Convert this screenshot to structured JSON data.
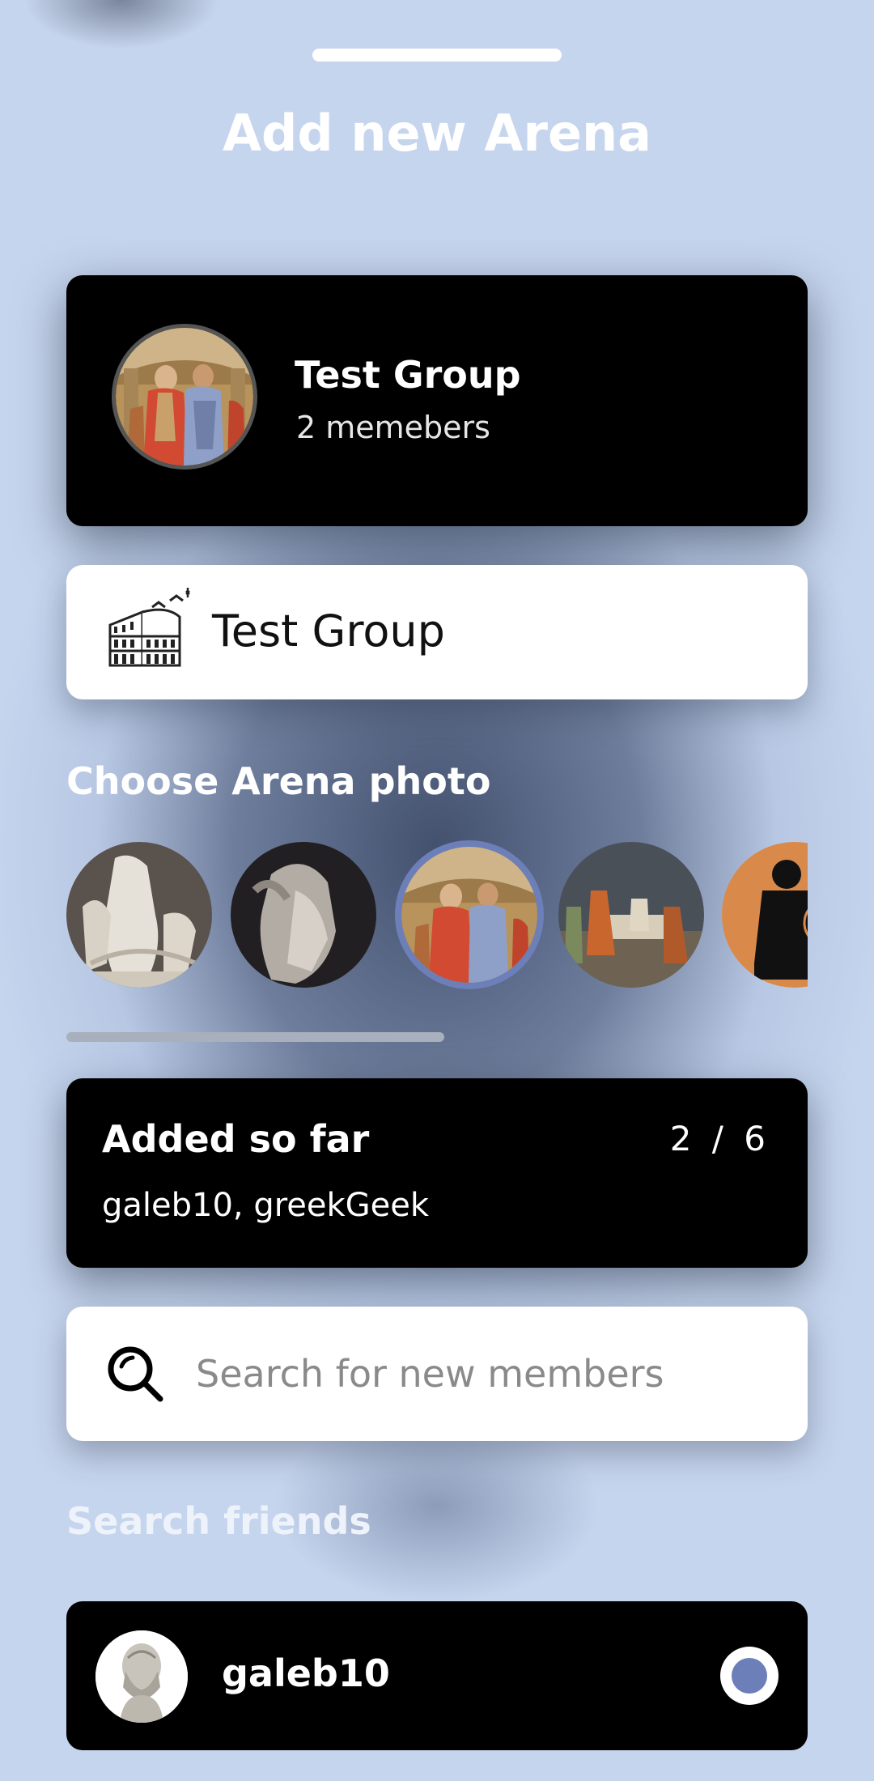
{
  "header": {
    "title": "Add new Arena"
  },
  "group_card": {
    "name": "Test Group",
    "members": "2 memebers",
    "avatar_icon": "school-of-athens-image"
  },
  "name_input": {
    "value": "Test Group",
    "icon": "colosseum-icon"
  },
  "photo_section": {
    "title": "Choose Arena photo",
    "photos": [
      {
        "name": "laocoon-statue-image",
        "selected": false
      },
      {
        "name": "rape-of-proserpina-statue-image",
        "selected": false
      },
      {
        "name": "school-of-athens-image",
        "selected": true
      },
      {
        "name": "death-of-socrates-image",
        "selected": false
      },
      {
        "name": "greek-pottery-warrior-image",
        "selected": false
      }
    ],
    "scroll_progress": 0.51,
    "accent_color": "#6c7fb8"
  },
  "added_card": {
    "title": "Added so far",
    "count": "2 / 6",
    "names": "galeb10, greekGeek"
  },
  "search": {
    "placeholder": "Search for new members",
    "value": "",
    "icon": "search-icon"
  },
  "friends_section": {
    "title": "Search friends",
    "friends": [
      {
        "name": "galeb10",
        "avatar": "hippocrates-bust-avatar",
        "selected": true
      }
    ]
  }
}
